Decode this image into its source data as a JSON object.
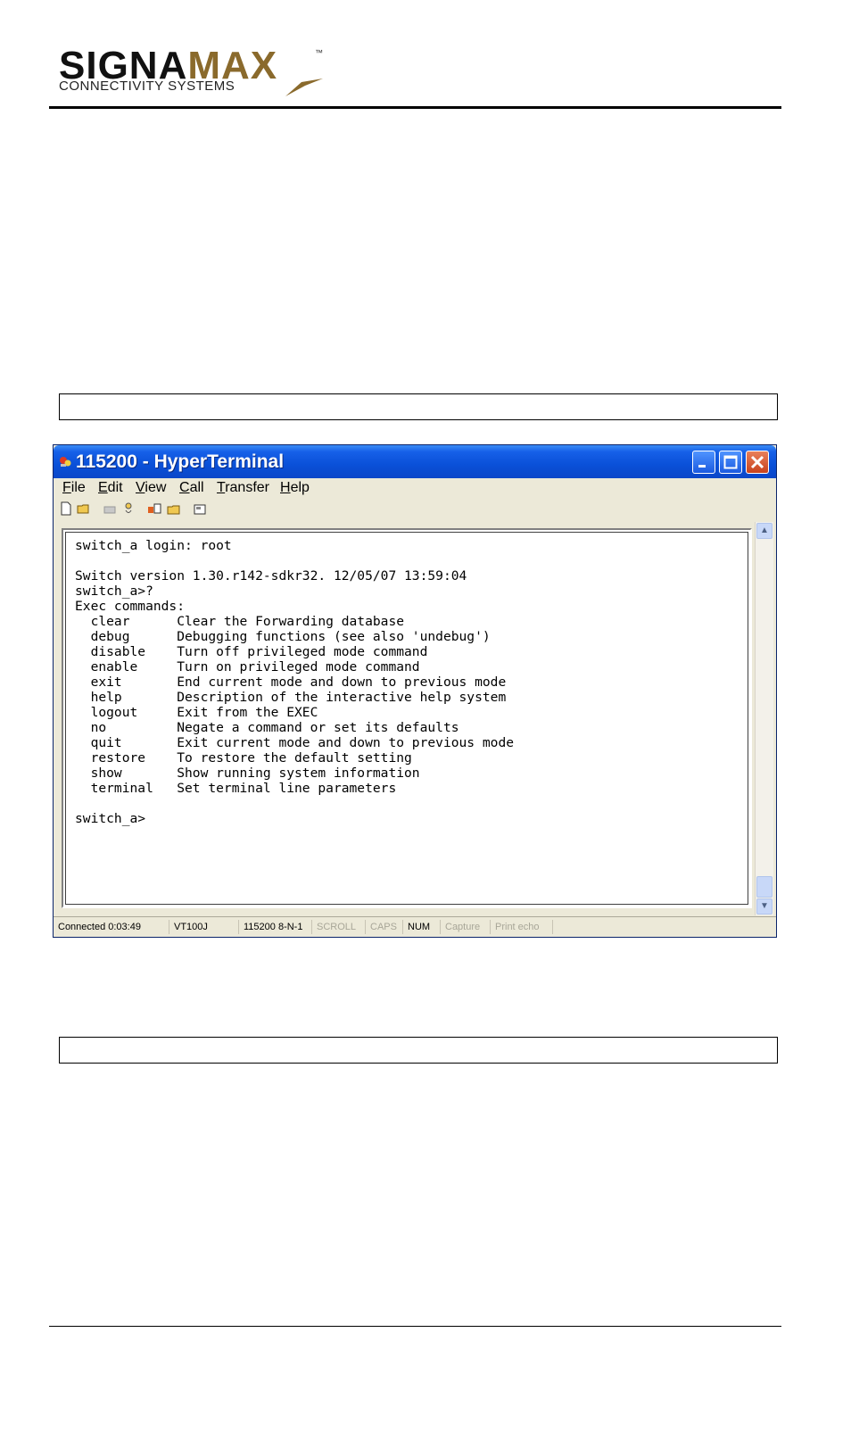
{
  "logo": {
    "part1": "SIGNA",
    "part2": "MAX",
    "tm": "™",
    "subtitle": "CONNECTIVITY SYSTEMS"
  },
  "window": {
    "title": "115200 - HyperTerminal",
    "menu": [
      {
        "label": "File",
        "accel": "F",
        "rest": "ile"
      },
      {
        "label": "Edit",
        "accel": "E",
        "rest": "dit"
      },
      {
        "label": "View",
        "accel": "V",
        "rest": "iew"
      },
      {
        "label": "Call",
        "accel": "C",
        "rest": "all"
      },
      {
        "label": "Transfer",
        "accel": "T",
        "rest": "ransfer"
      },
      {
        "label": "Help",
        "accel": "H",
        "rest": "elp"
      }
    ],
    "terminal_text": "switch_a login: root\n\nSwitch version 1.30.r142-sdkr32. 12/05/07 13:59:04\nswitch_a>?\nExec commands:\n  clear      Clear the Forwarding database\n  debug      Debugging functions (see also 'undebug')\n  disable    Turn off privileged mode command\n  enable     Turn on privileged mode command\n  exit       End current mode and down to previous mode\n  help       Description of the interactive help system\n  logout     Exit from the EXEC\n  no         Negate a command or set its defaults\n  quit       Exit current mode and down to previous mode\n  restore    To restore the default setting\n  show       Show running system information\n  terminal   Set terminal line parameters\n\nswitch_a>",
    "status": {
      "connected": "Connected 0:03:49",
      "emulation": "VT100J",
      "settings": "115200 8-N-1",
      "scroll": "SCROLL",
      "caps": "CAPS",
      "num": "NUM",
      "capture": "Capture",
      "print_echo": "Print echo"
    }
  }
}
